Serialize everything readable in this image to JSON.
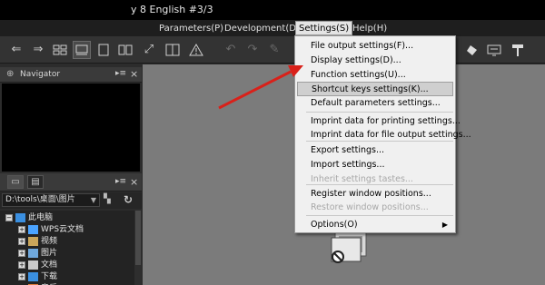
{
  "window": {
    "title_partial": "y 8 English  #3/3"
  },
  "menubar": {
    "parameters": "Parameters(P)",
    "development": "Development(D)",
    "settings": "Settings(S)",
    "help": "Help(H)"
  },
  "toolbar": {
    "icons": [
      "back-icon",
      "forward-icon",
      "grid-view-icon",
      "filmstrip-view-icon",
      "single-view-icon",
      "compare-view-icon",
      "fullscreen-icon",
      "dual-view-icon",
      "warning-icon",
      "undo-icon",
      "redo-icon",
      "paint-icon",
      "eraser-icon",
      "display-icon",
      "hammer-icon"
    ]
  },
  "navigator": {
    "title": "Navigator"
  },
  "browser": {
    "path": "D:\\tools\\桌面\\图片",
    "tree": [
      {
        "label": "此电脑",
        "indent": 0,
        "icon": "computer-icon"
      },
      {
        "label": "WPS云文档",
        "indent": 1,
        "icon": "cloud-icon"
      },
      {
        "label": "视频",
        "indent": 1,
        "icon": "video-folder-icon"
      },
      {
        "label": "图片",
        "indent": 1,
        "icon": "pictures-folder-icon"
      },
      {
        "label": "文档",
        "indent": 1,
        "icon": "documents-folder-icon"
      },
      {
        "label": "下载",
        "indent": 1,
        "icon": "download-folder-icon"
      },
      {
        "label": "音乐",
        "indent": 1,
        "icon": "music-folder-icon"
      }
    ]
  },
  "settings_menu": {
    "items": [
      {
        "label": "File output settings(F)...",
        "state": "normal"
      },
      {
        "label": "Display settings(D)...",
        "state": "normal"
      },
      {
        "label": "Function settings(U)...",
        "state": "normal"
      },
      {
        "label": "Shortcut keys settings(K)...",
        "state": "highlight"
      },
      {
        "label": "Default parameters settings...",
        "state": "normal"
      },
      {
        "label": "Imprint data for printing settings...",
        "state": "normal"
      },
      {
        "label": "Imprint data for file output settings...",
        "state": "normal"
      },
      {
        "label": "Export settings...",
        "state": "normal"
      },
      {
        "label": "Import settings...",
        "state": "normal"
      },
      {
        "label": "Inherit settings tastes...",
        "state": "disabled"
      },
      {
        "label": "Register window positions...",
        "state": "normal"
      },
      {
        "label": "Restore window positions...",
        "state": "disabled"
      },
      {
        "label": "Options(O)",
        "state": "submenu"
      }
    ]
  },
  "colors": {
    "menu_bg": "#f0f0f0",
    "highlight": "#cfcfcf",
    "canvas": "#7b7b7b",
    "annotation_arrow": "#d9211a"
  }
}
